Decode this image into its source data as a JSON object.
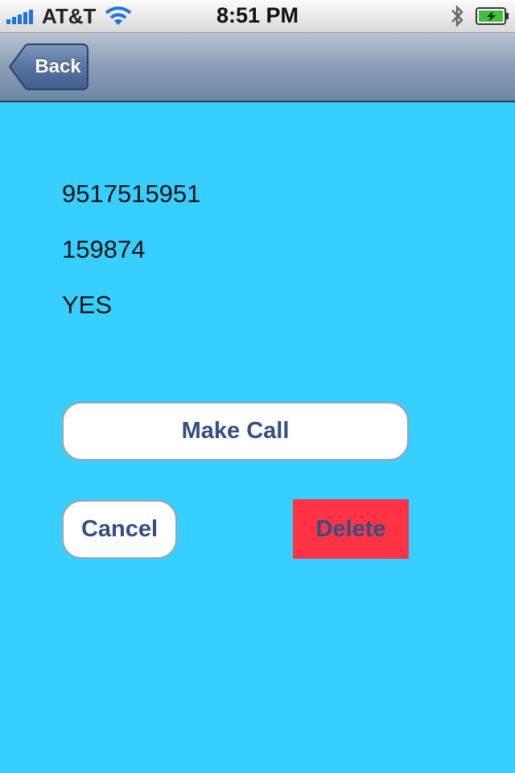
{
  "status_bar": {
    "carrier": "AT&T",
    "time": "8:51 PM"
  },
  "nav": {
    "back_label": "Back"
  },
  "details": {
    "phone": "9517515951",
    "code": "159874",
    "flag": "YES"
  },
  "actions": {
    "make_call": "Make Call",
    "cancel": "Cancel",
    "delete": "Delete"
  },
  "colors": {
    "background": "#37cfff",
    "delete": "#ff3344",
    "button_text": "#324f85"
  }
}
